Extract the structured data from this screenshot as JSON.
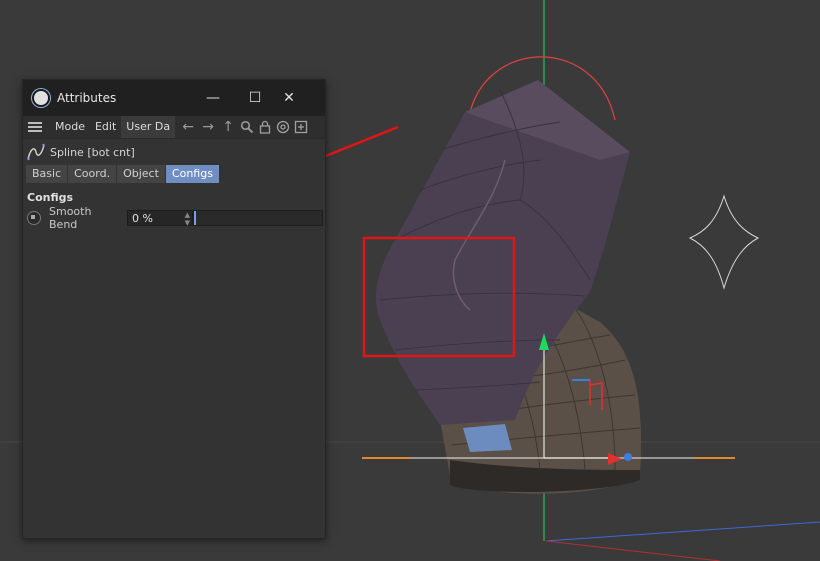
{
  "window": {
    "title": "Attributes",
    "controls": {
      "minimize": "—",
      "maximize": "☐",
      "close": "✕"
    }
  },
  "menubar": {
    "items": [
      "Mode",
      "Edit",
      "User Da"
    ]
  },
  "object": {
    "name": "Spline [bot cnt]"
  },
  "tabs": [
    {
      "label": "Basic",
      "active": false
    },
    {
      "label": "Coord.",
      "active": false
    },
    {
      "label": "Object",
      "active": false
    },
    {
      "label": "Configs",
      "active": true
    }
  ],
  "section": {
    "title": "Configs",
    "params": [
      {
        "label": "Smooth Bend",
        "value": "0 %",
        "slider": 0
      }
    ]
  },
  "colors": {
    "accent": "#6f8fc4",
    "annotation": "#e01515",
    "axis_y": "#1fd95a",
    "axis_x": "#e03030",
    "axis_z": "#3c7ee0"
  }
}
